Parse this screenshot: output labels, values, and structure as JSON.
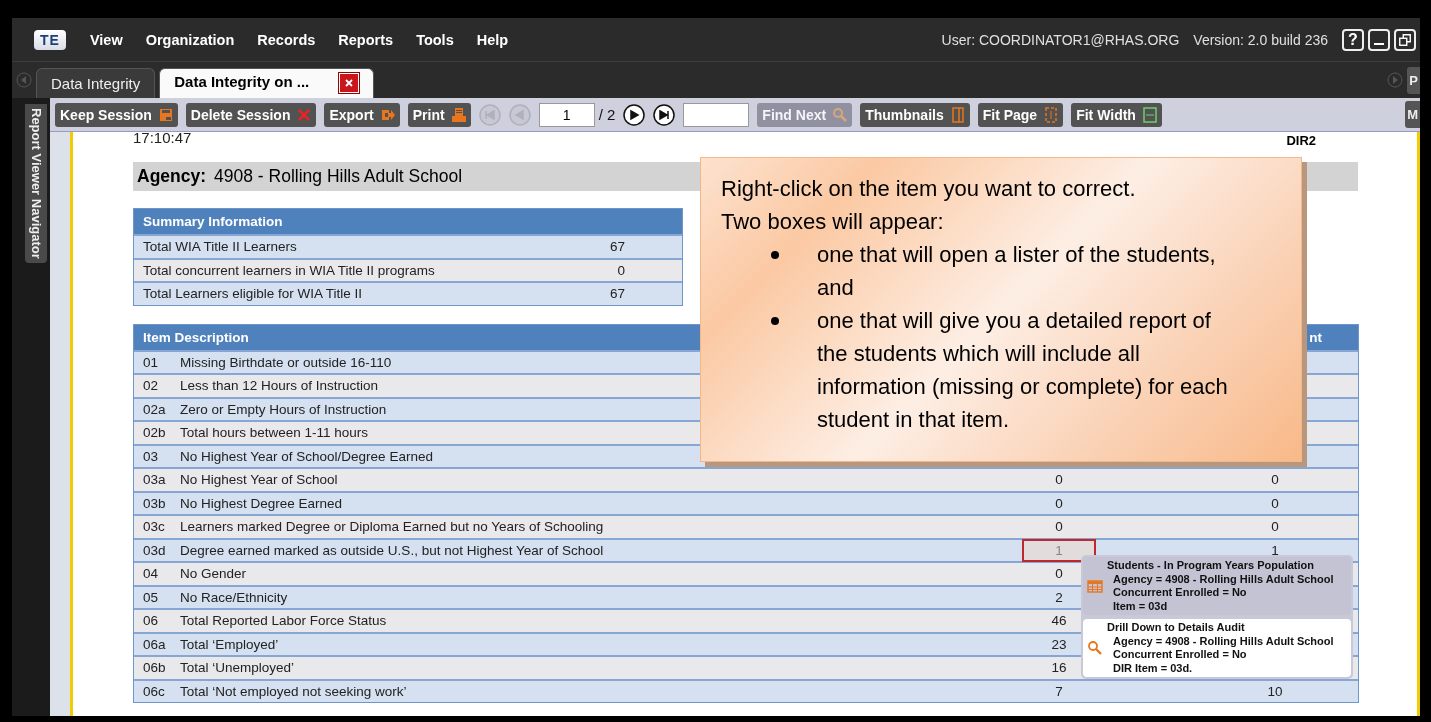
{
  "app": {
    "logo": "TE",
    "menu": [
      "View",
      "Organization",
      "Records",
      "Reports",
      "Tools",
      "Help"
    ],
    "user": "User: COORDINATOR1@RHAS.ORG",
    "version": "Version: 2.0 build 236",
    "help": "?"
  },
  "tabs": [
    {
      "label": "Data Integrity",
      "selected": false,
      "closable": false
    },
    {
      "label": "Data Integrity on ...",
      "selected": true,
      "closable": true
    }
  ],
  "tabs_overflow": "P",
  "side_navigator": "Report Viewer Navigator",
  "toolbar": {
    "left": [
      {
        "kind": "save",
        "label": "Keep Session",
        "disabled": false
      },
      {
        "kind": "delete",
        "label": "Delete Session",
        "disabled": false
      },
      {
        "kind": "export",
        "label": "Export",
        "disabled": false
      },
      {
        "kind": "print",
        "label": "Print",
        "disabled": false
      }
    ],
    "nav": [
      {
        "kind": "first",
        "disabled": true
      },
      {
        "kind": "prev",
        "disabled": true
      }
    ],
    "page": "1",
    "total": "/ 2",
    "nav2": [
      {
        "kind": "next",
        "disabled": false
      },
      {
        "kind": "last",
        "disabled": false
      }
    ],
    "right": [
      {
        "kind": "find",
        "label": "Find Next",
        "disabled": true
      },
      {
        "kind": "thumbnails",
        "label": "Thumbnails",
        "disabled": false
      },
      {
        "kind": "fitpage",
        "label": "Fit Page",
        "disabled": false
      },
      {
        "kind": "fitwidth",
        "label": "Fit Width",
        "disabled": false
      }
    ],
    "overflow": "M"
  },
  "report": {
    "time": "17:10:47",
    "code": "DIR2",
    "agency_label": "Agency:",
    "agency": "4908 - Rolling Hills Adult School",
    "summary": {
      "title": "Summary Information",
      "rows": [
        {
          "label": "Total WIA Title II Learners",
          "value": "67"
        },
        {
          "label": "Total concurrent learners in WIA Title II programs",
          "value": "0"
        },
        {
          "label": "Total Learners eligible for WIA Title II",
          "value": "67"
        }
      ]
    },
    "items": {
      "header": "Item Description",
      "column_3_header": "nt",
      "rows": [
        {
          "code": "01",
          "description": "Missing Birthdate or outside 16-110"
        },
        {
          "code": "02",
          "description": "Less than 12 Hours of Instruction"
        },
        {
          "code": "02a",
          "description": "Zero or Empty Hours of Instruction"
        },
        {
          "code": "02b",
          "description": "Total hours between 1-11 hours"
        },
        {
          "code": "03",
          "description": "No Highest Year of School/Degree Earned"
        },
        {
          "code": "03a",
          "description": "No Highest Year of School",
          "value_1": {
            "text": "0",
            "selected": false
          },
          "value_2": "0"
        },
        {
          "code": "03b",
          "description": "No Highest Degree Earned",
          "value_1": {
            "text": "0",
            "selected": false
          },
          "value_2": "0"
        },
        {
          "code": "03c",
          "description": "Learners marked Degree or Diploma Earned but no Years of Schooling",
          "value_1": {
            "text": "0",
            "selected": false
          },
          "value_2": "0"
        },
        {
          "code": "03d",
          "description": "Degree earned marked as outside U.S., but not Highest Year of School",
          "value_1": {
            "text": "1",
            "selected": true
          },
          "value_2": "1"
        },
        {
          "code": "04",
          "description": "No Gender",
          "value_1": {
            "text": "0",
            "selected": false
          }
        },
        {
          "code": "05",
          "description": "No Race/Ethnicity",
          "value_1": {
            "text": "2",
            "selected": false
          }
        },
        {
          "code": "06",
          "description": "Total Reported Labor Force Status",
          "value_1": {
            "text": "46",
            "selected": false
          }
        },
        {
          "code": "06a",
          "description": "Total ‘Employed’",
          "value_1": {
            "text": "23",
            "selected": false
          }
        },
        {
          "code": "06b",
          "description": "Total ‘Unemployed’",
          "value_1": {
            "text": "16",
            "selected": false
          }
        },
        {
          "code": "06c",
          "description": "Total ‘Not employed not seeking work’",
          "value_1": {
            "text": "7",
            "selected": false
          },
          "value_2": "10"
        }
      ]
    }
  },
  "callout": {
    "lines": [
      "Right-click on the item you want to correct.",
      "Two boxes will appear:"
    ],
    "bullets": [
      "one that will open a lister of the students, and",
      "one that will give you a detailed report of the students which will include all information (missing or complete) for each student in that item."
    ]
  },
  "context_menu": {
    "items": [
      {
        "kind": "lister",
        "title": "Students - In Program Years Population",
        "lines": [
          "Agency = 4908 - Rolling Hills Adult School",
          "Concurrent Enrolled = No",
          "Item = 03d"
        ],
        "selected": true
      },
      {
        "kind": "drill",
        "title": "Drill Down to Details Audit",
        "lines": [
          "Agency = 4908 - Rolling Hills Adult School",
          "Concurrent Enrolled = No",
          "DIR Item = 03d."
        ],
        "selected": false
      }
    ]
  }
}
